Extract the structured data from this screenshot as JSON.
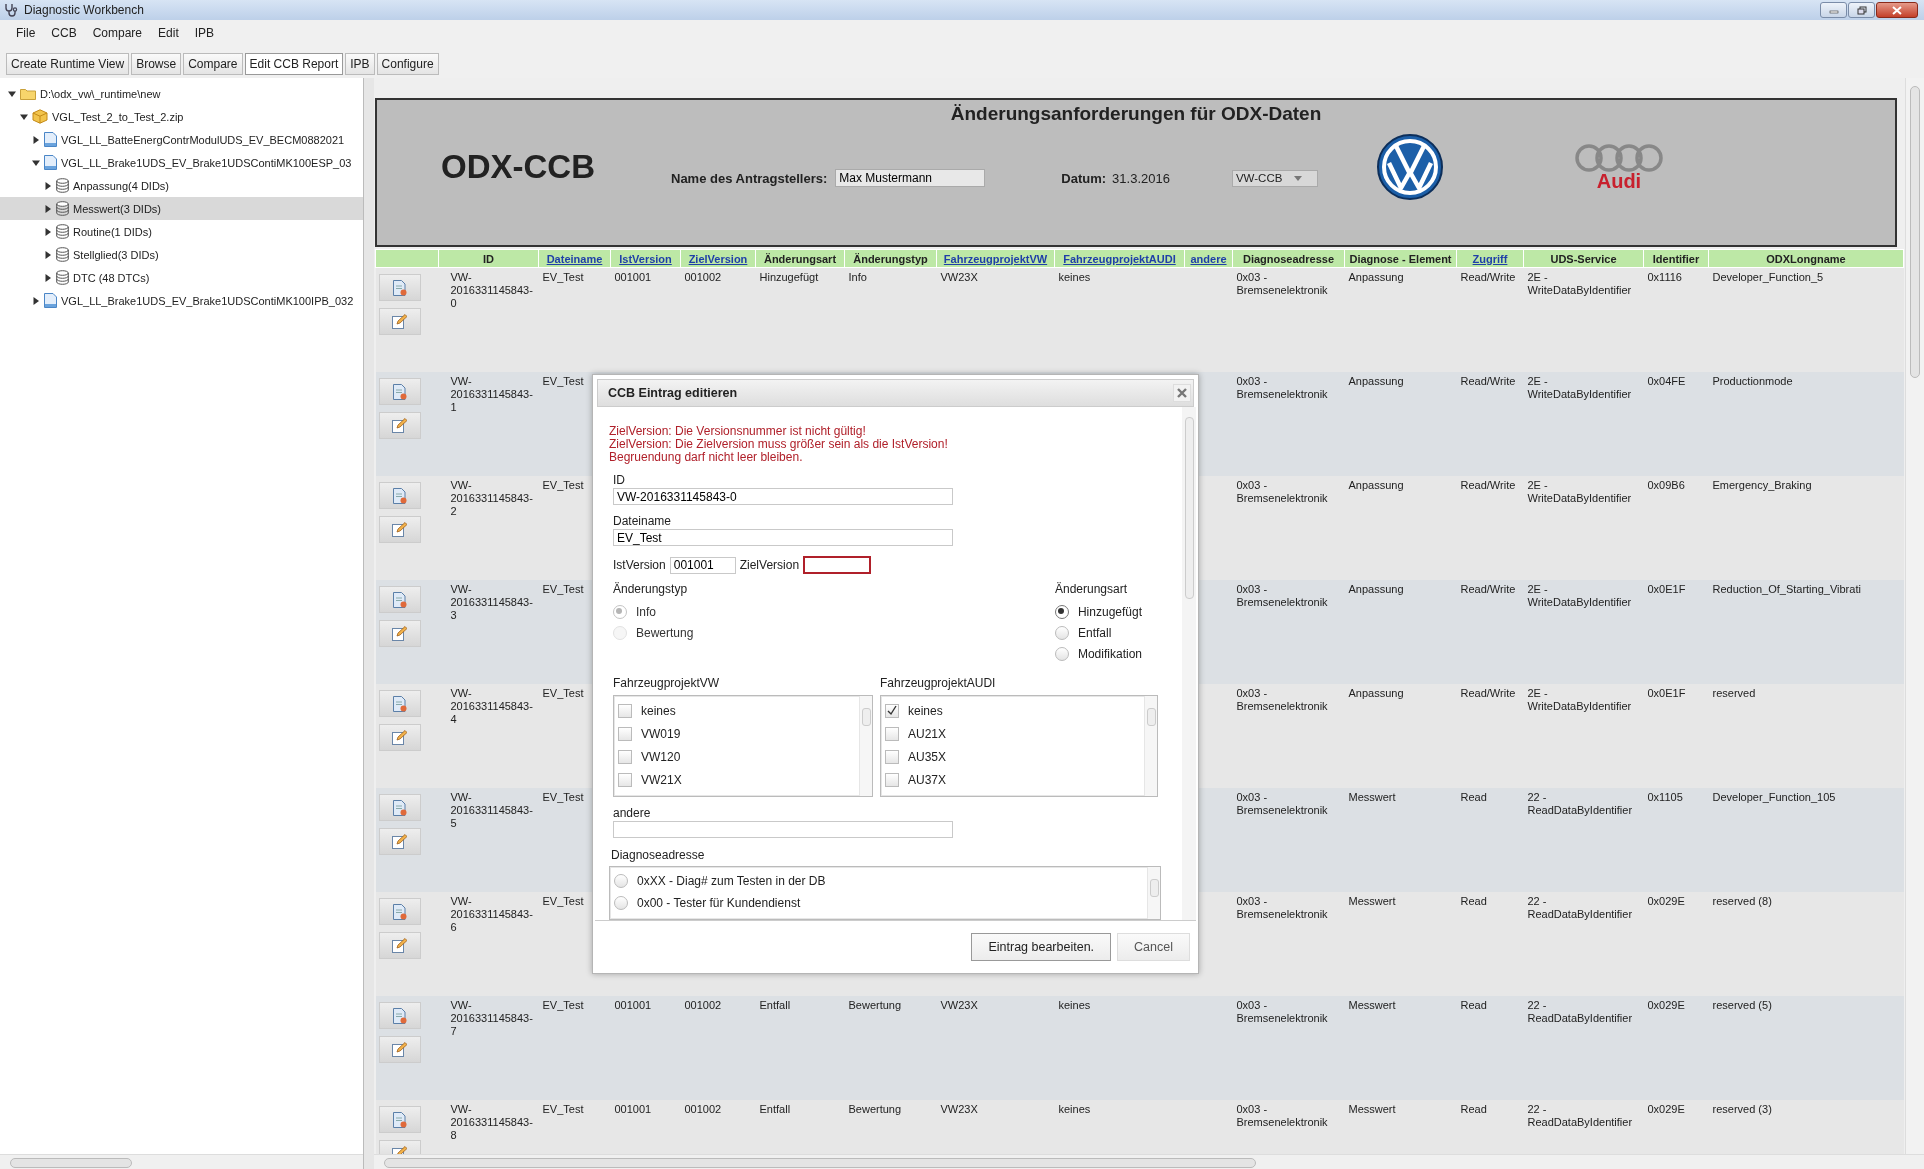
{
  "window": {
    "title": "Diagnostic Workbench"
  },
  "menu": [
    "File",
    "CCB",
    "Compare",
    "Edit",
    "IPB"
  ],
  "tabs": [
    {
      "label": "Create Runtime View",
      "selected": false
    },
    {
      "label": "Browse",
      "selected": false
    },
    {
      "label": "Compare",
      "selected": false
    },
    {
      "label": "Edit CCB Report",
      "selected": true
    },
    {
      "label": "IPB",
      "selected": false
    },
    {
      "label": "Configure",
      "selected": false
    }
  ],
  "tree": [
    {
      "label": "D:\\odx_vw\\_runtime\\new",
      "kind": "folder",
      "expanded": true,
      "selected": false,
      "children": [
        {
          "label": "VGL_Test_2_to_Test_2.zip",
          "kind": "package",
          "expanded": true,
          "selected": false,
          "children": [
            {
              "label": "VGL_LL_BatteEnergContrModulUDS_EV_BECM0882021",
              "kind": "file",
              "expanded": false,
              "selected": false
            },
            {
              "label": "VGL_LL_Brake1UDS_EV_Brake1UDSContiMK100ESP_03",
              "kind": "file",
              "expanded": true,
              "selected": false,
              "children": [
                {
                  "label": "Anpassung(4 DIDs)",
                  "kind": "database",
                  "expanded": false,
                  "selected": false
                },
                {
                  "label": "Messwert(3 DIDs)",
                  "kind": "database",
                  "expanded": false,
                  "selected": true
                },
                {
                  "label": "Routine(1 DIDs)",
                  "kind": "database",
                  "expanded": false,
                  "selected": false
                },
                {
                  "label": "Stellglied(3 DIDs)",
                  "kind": "database",
                  "expanded": false,
                  "selected": false
                },
                {
                  "label": "DTC (48 DTCs)",
                  "kind": "database",
                  "expanded": false,
                  "selected": false
                }
              ]
            },
            {
              "label": "VGL_LL_Brake1UDS_EV_Brake1UDSContiMK100IPB_032",
              "kind": "file",
              "expanded": false,
              "selected": false
            }
          ]
        }
      ]
    }
  ],
  "header": {
    "title": "Änderungsanforderungen für ODX-Daten",
    "product": "ODX-CCB",
    "applicant_label": "Name des Antragstellers:",
    "applicant": "Max Mustermann",
    "date_label": "Datum:",
    "date": "31.3.2016",
    "board": "VW-CCB",
    "logo_caption": "Audi"
  },
  "table": {
    "columns": [
      {
        "label": "ID",
        "link": false
      },
      {
        "label": "Dateiname",
        "link": true
      },
      {
        "label": "IstVersion",
        "link": true
      },
      {
        "label": "ZielVersion",
        "link": true
      },
      {
        "label": "Änderungsart",
        "link": false
      },
      {
        "label": "Änderungstyp",
        "link": false
      },
      {
        "label": "FahrzeugprojektVW",
        "link": true
      },
      {
        "label": "FahrzeugprojektAUDI",
        "link": true
      },
      {
        "label": "andere",
        "link": true
      },
      {
        "label": "Diagnoseadresse",
        "link": false
      },
      {
        "label": "Diagnose - Element",
        "link": false
      },
      {
        "label": "Zugriff",
        "link": true
      },
      {
        "label": "UDS-Service",
        "link": false
      },
      {
        "label": "Identifier",
        "link": false
      },
      {
        "label": "ODXLongname",
        "link": false
      }
    ],
    "rows": [
      {
        "id": "VW-2016331145843-0",
        "file": "EV_Test",
        "ist": "001001",
        "ziel": "001002",
        "art": "Hinzugefügt",
        "typ": "Info",
        "vw": "VW23X",
        "audi": "keines",
        "address": "0x03 - Bremsenelektronik",
        "element": "Anpassung",
        "access": "Read/Write",
        "service": "2E - WriteDataByIdentifier",
        "identifier": "0x1116",
        "longname": "Developer_Function_5"
      },
      {
        "id": "VW-2016331145843-1",
        "file": "EV_Test",
        "address": "0x03 - Bremsenelektronik",
        "element": "Anpassung",
        "access": "Read/Write",
        "service": "2E - WriteDataByIdentifier",
        "identifier": "0x04FE",
        "longname": "Productionmode"
      },
      {
        "id": "VW-2016331145843-2",
        "file": "EV_Test",
        "address": "0x03 - Bremsenelektronik",
        "element": "Anpassung",
        "access": "Read/Write",
        "service": "2E - WriteDataByIdentifier",
        "identifier": "0x09B6",
        "longname": "Emergency_Braking"
      },
      {
        "id": "VW-2016331145843-3",
        "file": "EV_Test",
        "address": "0x03 - Bremsenelektronik",
        "element": "Anpassung",
        "access": "Read/Write",
        "service": "2E - WriteDataByIdentifier",
        "identifier": "0x0E1F",
        "longname": "Reduction_Of_Starting_Vibrati"
      },
      {
        "id": "VW-2016331145843-4",
        "file": "EV_Test",
        "address": "0x03 - Bremsenelektronik",
        "element": "Anpassung",
        "access": "Read/Write",
        "service": "2E - WriteDataByIdentifier",
        "identifier": "0x0E1F",
        "longname": "reserved"
      },
      {
        "id": "VW-2016331145843-5",
        "file": "EV_Test",
        "address": "0x03 - Bremsenelektronik",
        "element": "Messwert",
        "access": "Read",
        "service": "22 - ReadDataByIdentifier",
        "identifier": "0x1105",
        "longname": "Developer_Function_105"
      },
      {
        "id": "VW-2016331145843-6",
        "file": "EV_Test",
        "address": "0x03 - Bremsenelektronik",
        "element": "Messwert",
        "access": "Read",
        "service": "22 - ReadDataByIdentifier",
        "identifier": "0x029E",
        "longname": "reserved (8)"
      },
      {
        "id": "VW-2016331145843-7",
        "file": "EV_Test",
        "ist": "001001",
        "ziel": "001002",
        "art": "Entfall",
        "typ": "Bewertung",
        "vw": "VW23X",
        "audi": "keines",
        "address": "0x03 - Bremsenelektronik",
        "element": "Messwert",
        "access": "Read",
        "service": "22 - ReadDataByIdentifier",
        "identifier": "0x029E",
        "longname": "reserved (5)"
      },
      {
        "id": "VW-2016331145843-8",
        "file": "EV_Test",
        "ist": "001001",
        "ziel": "001002",
        "art": "Entfall",
        "typ": "Bewertung",
        "vw": "VW23X",
        "audi": "keines",
        "address": "0x03 - Bremsenelektronik",
        "element": "Messwert",
        "access": "Read",
        "service": "22 - ReadDataByIdentifier",
        "identifier": "0x029E",
        "longname": "reserved (3)"
      }
    ]
  },
  "dialog": {
    "title": "CCB Eintrag editieren",
    "errors": [
      "ZielVersion: Die Versionsnummer ist nicht gültig!",
      "ZielVersion: Die Zielversion muss größer sein als die IstVersion!",
      "Begruendung darf nicht leer bleiben."
    ],
    "id_label": "ID",
    "id": "VW-2016331145843-0",
    "file_label": "Dateiname",
    "file": "EV_Test",
    "ist_label": "IstVersion",
    "ist": "001001",
    "ziel_label": "ZielVersion",
    "ziel_invalid": true,
    "type_group": {
      "label": "Änderungstyp",
      "disabled": true,
      "options": [
        {
          "label": "Info",
          "selected": true
        },
        {
          "label": "Bewertung",
          "selected": false
        }
      ]
    },
    "kind_group": {
      "label": "Änderungsart",
      "disabled": false,
      "options": [
        {
          "label": "Hinzugefügt",
          "selected": true
        },
        {
          "label": "Entfall",
          "selected": false
        },
        {
          "label": "Modifikation",
          "selected": false
        }
      ]
    },
    "vw_projects": {
      "label": "FahrzeugprojektVW",
      "items": [
        {
          "label": "keines",
          "checked": false
        },
        {
          "label": "VW019",
          "checked": false
        },
        {
          "label": "VW120",
          "checked": false
        },
        {
          "label": "VW21X",
          "checked": false
        }
      ]
    },
    "audi_projects": {
      "label": "FahrzeugprojektAUDI",
      "items": [
        {
          "label": "keines",
          "checked": true
        },
        {
          "label": "AU21X",
          "checked": false
        },
        {
          "label": "AU35X",
          "checked": false
        },
        {
          "label": "AU37X",
          "checked": false
        }
      ]
    },
    "other_label": "andere",
    "address": {
      "label": "Diagnoseadresse",
      "options": [
        {
          "label": "0xXX - Diag# zum Testen in der DB",
          "selected": false
        },
        {
          "label": "0x00 - Tester für Kundendienst",
          "selected": false
        }
      ]
    },
    "buttons": [
      {
        "label": "Eintrag bearbeiten.",
        "kind": "primary"
      },
      {
        "label": "Cancel",
        "kind": "secondary"
      }
    ]
  }
}
